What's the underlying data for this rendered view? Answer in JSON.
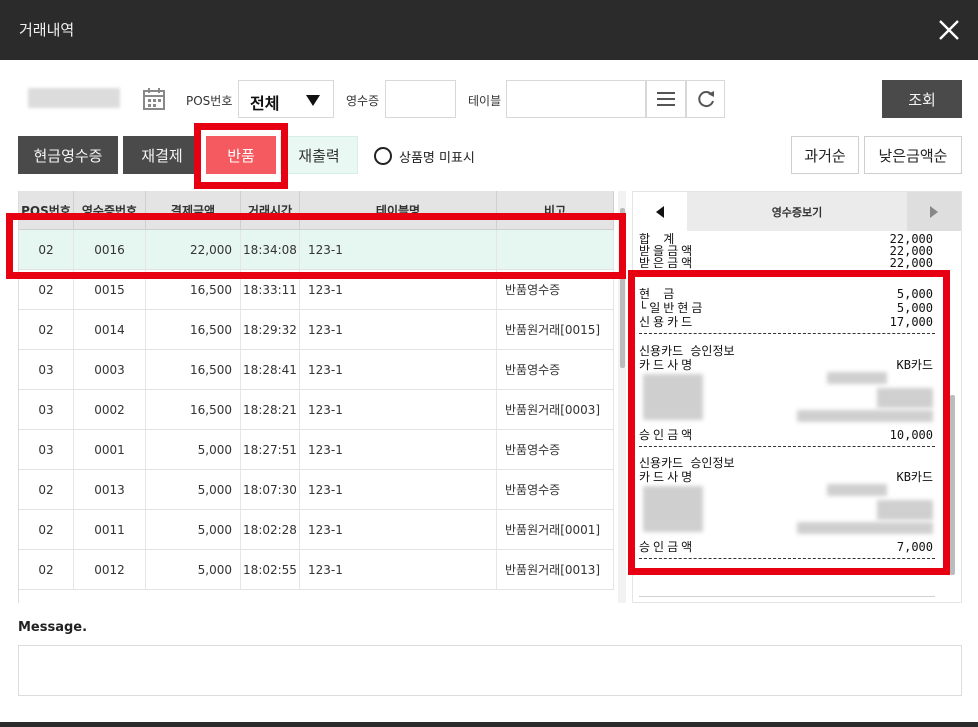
{
  "window": {
    "title": "거래내역"
  },
  "filters": {
    "pos_label": "POS번호",
    "pos_value": "전체",
    "receipt_label": "영수증",
    "table_label": "테이블",
    "search_button": "조회"
  },
  "actions": {
    "cash_receipt": "현금영수증",
    "repay": "재결제",
    "refund": "반품",
    "reprint": "재출력",
    "hide_product_name": "상품명 미표시",
    "sort_past": "과거순",
    "sort_low_amount": "낮은금액순"
  },
  "grid": {
    "columns": [
      "POS번호",
      "영수증번호",
      "결제금액",
      "거래시간",
      "테이블명",
      "비고"
    ],
    "rows": [
      [
        "02",
        "0016",
        "22,000",
        "18:34:08",
        "123-1",
        ""
      ],
      [
        "02",
        "0015",
        "16,500",
        "18:33:11",
        "123-1",
        "반품영수증"
      ],
      [
        "02",
        "0014",
        "16,500",
        "18:29:32",
        "123-1",
        "반품원거래[0015]"
      ],
      [
        "03",
        "0003",
        "16,500",
        "18:28:41",
        "123-1",
        "반품영수증"
      ],
      [
        "03",
        "0002",
        "16,500",
        "18:28:21",
        "123-1",
        "반품원거래[0003]"
      ],
      [
        "03",
        "0001",
        "5,000",
        "18:27:51",
        "123-1",
        "반품영수증"
      ],
      [
        "02",
        "0013",
        "5,000",
        "18:07:30",
        "123-1",
        "반품영수증"
      ],
      [
        "02",
        "0011",
        "5,000",
        "18:02:28",
        "123-1",
        "반품원거래[0001]"
      ],
      [
        "02",
        "0012",
        "5,000",
        "18:02:55",
        "123-1",
        "반품원거래[0013]"
      ]
    ]
  },
  "receipt": {
    "title": "영수증보기",
    "lines": {
      "total_label": "합 계",
      "total_value": "22,000",
      "recv_label": "받을금액",
      "recv_value": "22,000",
      "recv2_label": "받은금액",
      "recv2_value": "22,000",
      "cash_label": "현 금",
      "cash_value": "5,000",
      "cash_receipt_label": "└일반현금",
      "cash_receipt_value": "5,000",
      "card_label": "신용카드",
      "card_value": "17,000",
      "approval1_title": "신용카드 승인정보",
      "issuer1_label": "카드사명",
      "issuer1_value": "KB카드",
      "approved1_label": "승인금액",
      "approved1_value": "10,000",
      "approval2_title": "신용카드 승인정보",
      "issuer2_label": "카드사명",
      "issuer2_value": "KB카드",
      "approved2_label": "승인금액",
      "approved2_value": "7,000"
    }
  },
  "message": {
    "label": "Message."
  }
}
